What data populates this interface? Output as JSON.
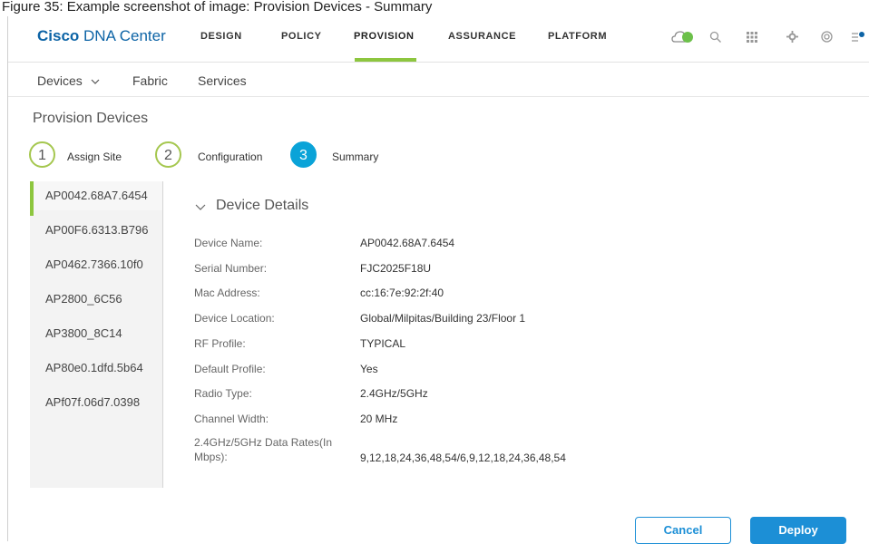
{
  "caption": "Figure 35:      Example screenshot of image: Provision Devices - Summary",
  "app": {
    "brand_bold": "Cisco",
    "brand_rest": "DNA Center"
  },
  "nav": {
    "items": [
      "DESIGN",
      "POLICY",
      "PROVISION",
      "ASSURANCE",
      "PLATFORM"
    ],
    "active": "PROVISION",
    "icons": [
      "cloud-status-icon",
      "search-icon",
      "apps-grid-icon",
      "settings-gear-icon",
      "help-icon",
      "notifications-icon"
    ]
  },
  "subnav": {
    "devices": "Devices",
    "fabric": "Fabric",
    "services": "Services"
  },
  "page_title": "Provision Devices",
  "steps": [
    {
      "num": "1",
      "label": "Assign Site"
    },
    {
      "num": "2",
      "label": "Configuration"
    },
    {
      "num": "3",
      "label": "Summary"
    }
  ],
  "devices": [
    "AP0042.68A7.6454",
    "AP00F6.6313.B796",
    "AP0462.7366.10f0",
    "AP2800_6C56",
    "AP3800_8C14",
    "AP80e0.1dfd.5b64",
    "APf07f.06d7.0398"
  ],
  "details": {
    "title": "Device Details",
    "rows": [
      {
        "label": "Device Name:",
        "value": "AP0042.68A7.6454"
      },
      {
        "label": "Serial Number:",
        "value": "FJC2025F18U"
      },
      {
        "label": "Mac Address:",
        "value": "cc:16:7e:92:2f:40"
      },
      {
        "label": "Device Location:",
        "value": "Global/Milpitas/Building 23/Floor 1"
      },
      {
        "label": "RF Profile:",
        "value": "TYPICAL"
      },
      {
        "label": "Default Profile:",
        "value": "Yes"
      },
      {
        "label": "Radio Type:",
        "value": "2.4GHz/5GHz"
      },
      {
        "label": "Channel Width:",
        "value": "20 MHz"
      },
      {
        "label_line1": "2.4GHz/5GHz Data Rates(In",
        "label_line2": "Mbps):",
        "value": "9,12,18,24,36,48,54/6,9,12,18,24,36,48,54"
      }
    ]
  },
  "buttons": {
    "cancel": "Cancel",
    "deploy": "Deploy"
  },
  "colors": {
    "brand": "#0d64a6",
    "accent_green": "#8dc63f",
    "step_current": "#0aa3d8",
    "button_blue": "#1c8fd6"
  }
}
